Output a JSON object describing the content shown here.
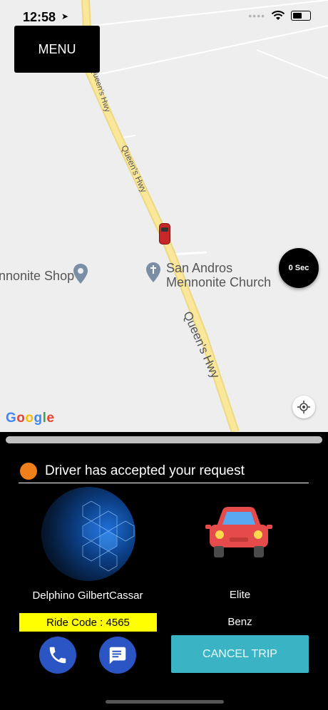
{
  "status_bar": {
    "time": "12:58"
  },
  "menu": {
    "label": "MENU"
  },
  "map": {
    "labels": {
      "road_top": "Queen's Hwy",
      "road_middle": "Queen's Hwy",
      "road_bottom": "Queen's Hwy",
      "church_line1": "San Andros",
      "church_line2": "Mennonite Church",
      "shop": "nnonite Shop"
    },
    "timer": "0 Sec",
    "provider_logo": "Google"
  },
  "trip": {
    "status_text": "Driver has accepted your request",
    "status_color": "#ef7f1a",
    "driver_name": "Delphino GilbertCassar",
    "ride_code": "Ride Code : 4565",
    "car_type": "Elite",
    "car_model": "Benz",
    "cancel_label": "CANCEL TRIP"
  },
  "colors": {
    "ride_code_bg": "#ffff00",
    "action_button": "#2a55c3",
    "cancel_button": "#3ab4c4"
  }
}
